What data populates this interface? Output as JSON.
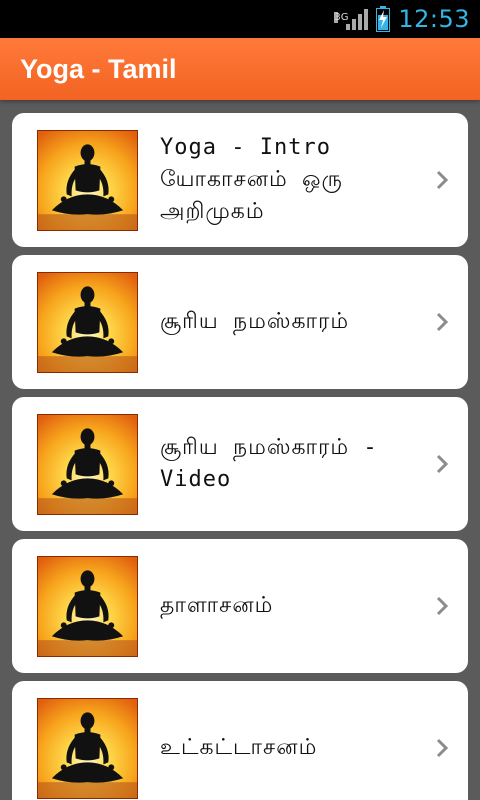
{
  "status_bar": {
    "network": "3G",
    "time": "12:53"
  },
  "app_bar": {
    "title": "Yoga - Tamil"
  },
  "colors": {
    "accent": "#f36321",
    "status_text": "#33b5e5",
    "background": "#5b5b5b"
  },
  "items": [
    {
      "label": "Yoga - Intro\nயோகாசனம் ஒரு\nஅறிமுகம்",
      "thumbnail_icon": "meditation-silhouette",
      "action_icon": "chevron-right-icon"
    },
    {
      "label": "சூரிய நமஸ்காரம்",
      "thumbnail_icon": "meditation-silhouette",
      "action_icon": "chevron-right-icon"
    },
    {
      "label": "சூரிய நமஸ்காரம் -\nVideo",
      "thumbnail_icon": "meditation-silhouette",
      "action_icon": "chevron-right-icon"
    },
    {
      "label": "தாளாசனம்",
      "thumbnail_icon": "meditation-silhouette",
      "action_icon": "chevron-right-icon"
    },
    {
      "label": "உட்கட்டாசனம்",
      "thumbnail_icon": "meditation-silhouette",
      "action_icon": "chevron-right-icon"
    }
  ]
}
